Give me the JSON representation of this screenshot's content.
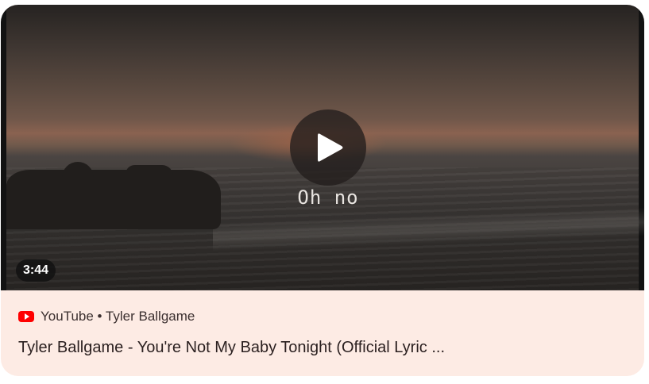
{
  "video": {
    "lyric_overlay": "Oh no",
    "duration": "3:44",
    "play_icon": "play-icon"
  },
  "meta": {
    "icon": "youtube-icon",
    "source": "YouTube",
    "separator": "•",
    "channel": "Tyler Ballgame",
    "title": "Tyler Ballgame - You're Not My Baby Tonight (Official Lyric ..."
  },
  "colors": {
    "card_background": "#fdebe4",
    "youtube_red": "#ff0000",
    "duration_badge": "#121212"
  }
}
